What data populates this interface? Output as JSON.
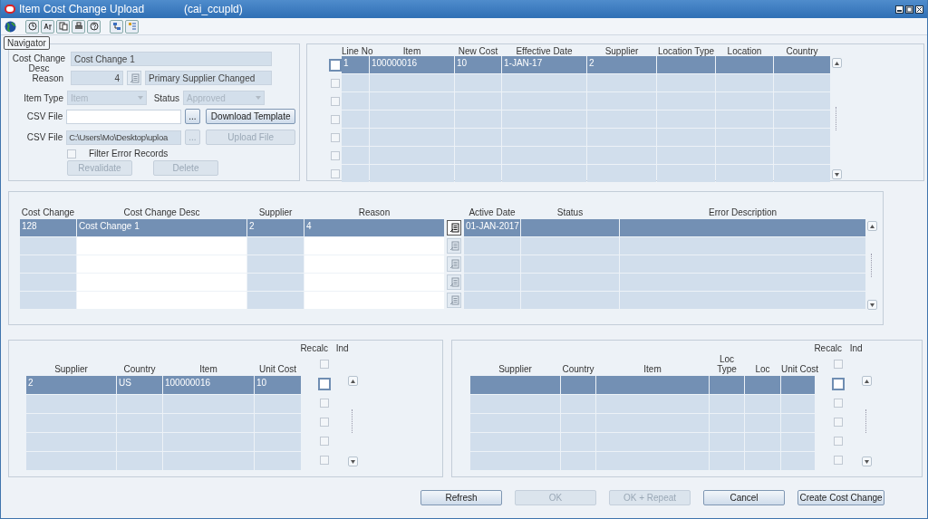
{
  "window": {
    "title": "Item Cost Change Upload",
    "form_name": "(cai_ccupld)"
  },
  "tooltip": "Navigator",
  "header": {
    "desc_label": "Cost Change Desc",
    "desc_value": "Cost Change 1",
    "reason_label": "Reason",
    "reason_code": "4",
    "reason_desc": "Primary Supplier Changed",
    "item_type_label": "Item Type",
    "item_type_value": "Item",
    "status_label": "Status",
    "status_value": "Approved",
    "csv_rows": [
      {
        "label": "CSV File",
        "browse": "...",
        "button": "Download Template",
        "button_disabled": false,
        "browse_disabled": false
      },
      {
        "label": "CSV File",
        "value": "C:\\Users\\Mo\\Desktop\\uploa",
        "browse": "...",
        "button": "Upload File",
        "button_disabled": true,
        "browse_disabled": true
      }
    ],
    "filter": {
      "label": "Filter Error Records",
      "checked": false
    },
    "buttons": [
      {
        "label": "Revalidate",
        "disabled": true
      },
      {
        "label": "Delete",
        "disabled": true
      }
    ]
  },
  "lines": {
    "columns": [
      "Line No",
      "Item",
      "New Cost",
      "Effective Date",
      "Supplier",
      "Location Type",
      "Location",
      "Country"
    ],
    "rows": [
      {
        "selected": true,
        "checked": false,
        "cells": [
          "1",
          "100000016",
          "10",
          "1-JAN-17",
          "2"
        ]
      },
      {
        "selected": false,
        "checked": false
      },
      {
        "selected": false,
        "checked": false
      },
      {
        "selected": false,
        "checked": false
      },
      {
        "selected": false,
        "checked": false
      },
      {
        "selected": false,
        "checked": false
      },
      {
        "selected": false,
        "checked": false
      }
    ]
  },
  "cost_changes": {
    "columns": [
      "Cost Change",
      "Cost Change Desc",
      "Supplier",
      "Reason",
      "Active Date",
      "Status",
      "Error Description"
    ],
    "rows": [
      {
        "selected": true,
        "cells": [
          "128",
          "Cost Change 1",
          "2",
          "4",
          "01-JAN-2017"
        ]
      },
      {
        "selected": false
      },
      {
        "selected": false
      },
      {
        "selected": false
      },
      {
        "selected": false
      }
    ]
  },
  "supplier_grid": {
    "columns": [
      "Supplier",
      "Country",
      "Item",
      "Unit Cost"
    ],
    "recalc_label": "Recalc Ind",
    "header_checked": false,
    "rows": [
      {
        "selected": true,
        "checked": false,
        "cells": [
          "2",
          "US",
          "100000016",
          "10"
        ]
      },
      {
        "selected": false,
        "checked": false
      },
      {
        "selected": false,
        "checked": false
      },
      {
        "selected": false,
        "checked": false
      },
      {
        "selected": false,
        "checked": false
      }
    ]
  },
  "location_grid": {
    "columns": [
      "Supplier",
      "Country",
      "Item",
      "Loc Type",
      "Loc",
      "Unit Cost"
    ],
    "recalc_label": "Recalc Ind",
    "header_checked": false,
    "rows": [
      {
        "selected": true,
        "checked": false
      },
      {
        "selected": false,
        "checked": false
      },
      {
        "selected": false,
        "checked": false
      },
      {
        "selected": false,
        "checked": false
      },
      {
        "selected": false,
        "checked": false
      }
    ]
  },
  "footer_buttons": [
    {
      "label": "Refresh",
      "disabled": false
    },
    {
      "label": "OK",
      "disabled": true
    },
    {
      "label": "OK + Repeat",
      "disabled": true
    },
    {
      "label": "Cancel",
      "disabled": false
    },
    {
      "label": "Create Cost Change",
      "disabled": false
    }
  ]
}
